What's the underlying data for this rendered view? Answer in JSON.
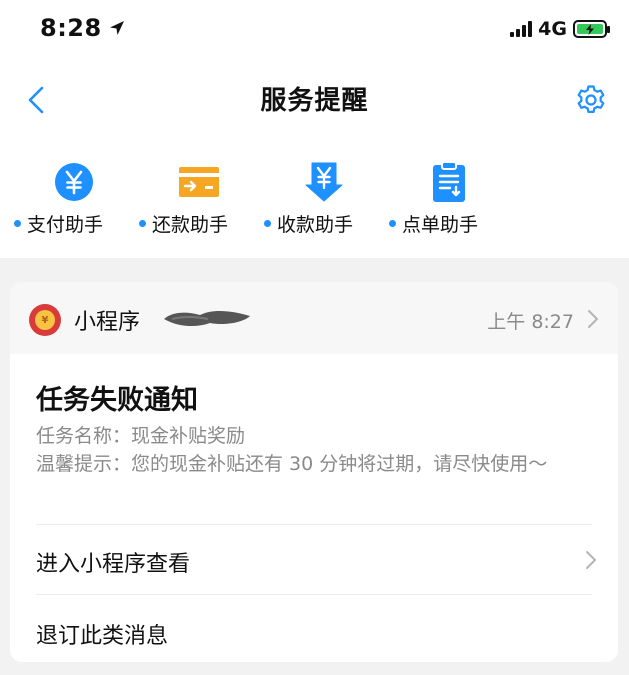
{
  "status_bar": {
    "time": "8:28",
    "network": "4G"
  },
  "nav": {
    "title": "服务提醒"
  },
  "shortcuts": [
    {
      "label": "支付助手",
      "icon": "yuan-circle-icon"
    },
    {
      "label": "还款助手",
      "icon": "card-repay-icon"
    },
    {
      "label": "收款助手",
      "icon": "yuan-arrow-down-icon"
    },
    {
      "label": "点单助手",
      "icon": "clipboard-order-icon"
    }
  ],
  "card": {
    "source_name": "小程序",
    "time": "上午 8:27",
    "title": "任务失败通知",
    "line1": "任务名称：现金补贴奖励",
    "line2": "温馨提示：您的现金补贴还有 30 分钟将过期，请尽快使用～",
    "action_enter": "进入小程序查看",
    "action_unsubscribe": "退订此类消息"
  },
  "colors": {
    "accent_blue": "#1e90ff",
    "repay_orange": "#f5a623",
    "battery_green": "#34c759",
    "muted_text": "#8a8a8a"
  }
}
